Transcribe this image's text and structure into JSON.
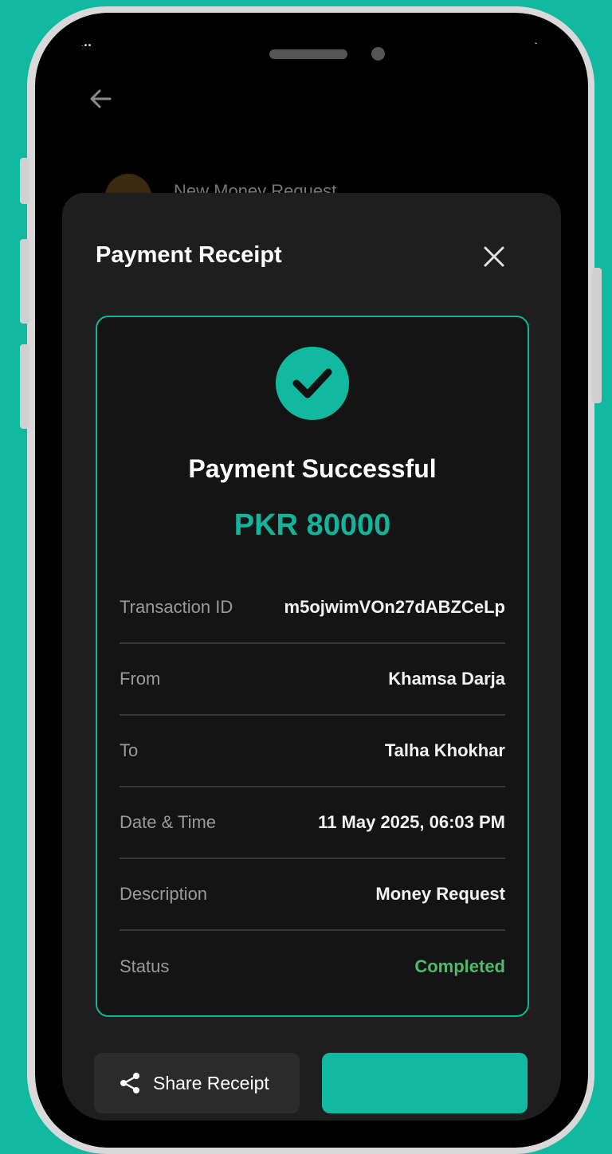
{
  "status_bar": {
    "time": "...",
    "icons": "..."
  },
  "background_screen": {
    "item_title": "New Money Request"
  },
  "receipt": {
    "title": "Payment Receipt",
    "success_title": "Payment Successful",
    "amount": "PKR 80000",
    "rows": [
      {
        "label": "Transaction ID",
        "value": "m5ojwimVOn27dABZCeLp"
      },
      {
        "label": "From",
        "value": "Khamsa Darja"
      },
      {
        "label": "To",
        "value": "Talha Khokhar"
      },
      {
        "label": "Date & Time",
        "value": "11 May 2025, 06:03 PM"
      },
      {
        "label": "Description",
        "value": "Money Request"
      },
      {
        "label": "Status",
        "value": "Completed"
      }
    ],
    "share_label": "Share Receipt",
    "primary_label": ""
  },
  "icons": {
    "back": "arrow-left-icon",
    "close": "close-icon",
    "check": "check-circle-icon",
    "share": "share-icon"
  },
  "colors": {
    "accent": "#10b9a0",
    "status_completed": "#4cbb6b",
    "sheet_bg": "#1e1e1e",
    "card_bg": "#141414"
  }
}
